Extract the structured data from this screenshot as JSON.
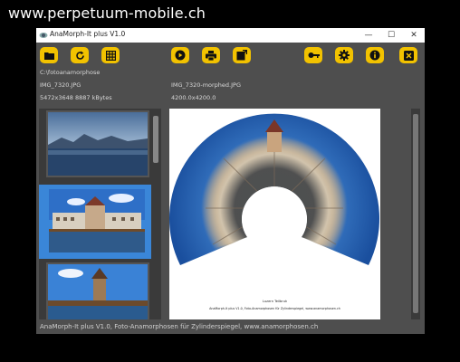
{
  "watermark": {
    "url": "www.perpetuum-mobile.ch"
  },
  "window": {
    "title": "AnaMorph-It plus V1.0"
  },
  "window_controls": {
    "minimize": "—",
    "maximize": "☐",
    "close": "✕"
  },
  "toolbar": {
    "left": [
      {
        "name": "open-folder",
        "icon": "folder-icon"
      },
      {
        "name": "refresh",
        "icon": "refresh-icon"
      },
      {
        "name": "grid",
        "icon": "grid-icon"
      }
    ],
    "center": [
      {
        "name": "play",
        "icon": "play-icon"
      },
      {
        "name": "print",
        "icon": "printer-icon"
      },
      {
        "name": "export",
        "icon": "export-icon"
      }
    ],
    "right": [
      {
        "name": "license",
        "icon": "key-icon"
      },
      {
        "name": "settings",
        "icon": "gear-icon"
      },
      {
        "name": "info",
        "icon": "info-icon"
      },
      {
        "name": "exit",
        "icon": "exit-icon"
      }
    ],
    "button_color": "#f2c200"
  },
  "source": {
    "folder": "C:\\fotoanamorphose",
    "filename": "IMG_7320.JPG",
    "details": "5472x3648 8887 kBytes"
  },
  "output": {
    "filename": "IMG_7320-morphed.JPG",
    "details": "4200.0x4200.0",
    "caption_title": "Luzern Teilbruk",
    "caption_line": "AnaMorph-It plus V1.0, Foto-Anamorphosen für Zylinderspiegel, www.anamorphosen.ch"
  },
  "thumbnails": [
    {
      "label": "lake-mountains",
      "selected": false
    },
    {
      "label": "lucerne-old-town",
      "selected": true
    },
    {
      "label": "water-tower-bridge",
      "selected": false
    }
  ],
  "status": {
    "text": "AnaMorph-It plus V1.0, Foto-Anamorphosen für Zylinderspiegel, www.anamorphosen.ch"
  },
  "colors": {
    "selection": "#3a86d8",
    "window_bg": "#4e4e4e",
    "panel_bg": "#3a3a3a"
  }
}
